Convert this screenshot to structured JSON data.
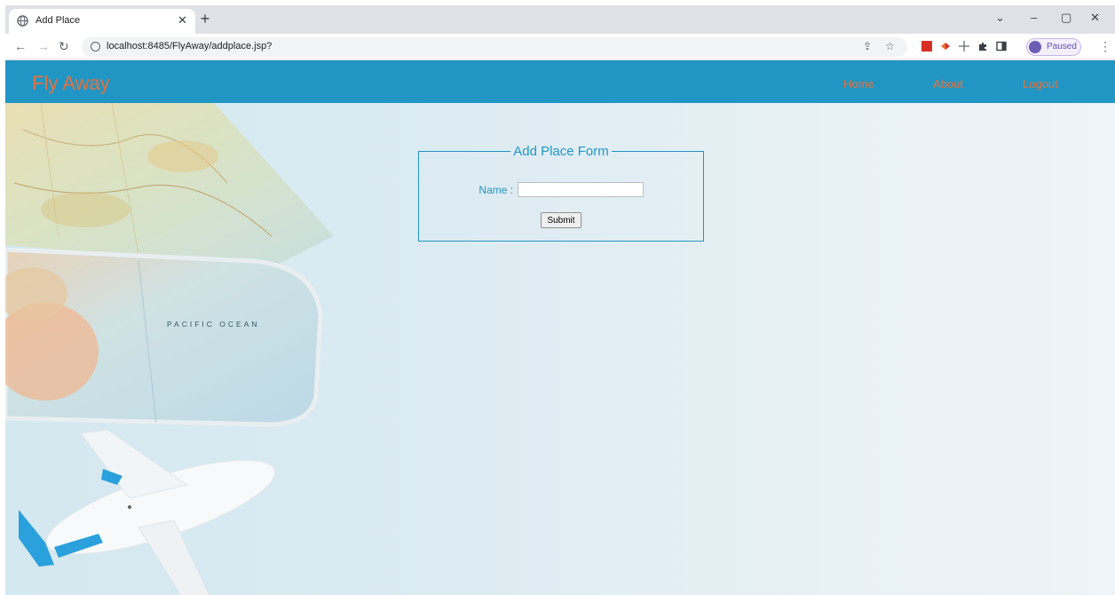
{
  "browser": {
    "tab_title": "Add Place",
    "url": "localhost:8485/FlyAway/addplace.jsp?",
    "profile_label": "Paused"
  },
  "site": {
    "brand": "Fly Away",
    "nav": [
      {
        "label": "Home"
      },
      {
        "label": "About"
      },
      {
        "label": "Logout"
      }
    ]
  },
  "form": {
    "legend": "Add Place Form",
    "name_label": "Name :",
    "name_value": "",
    "submit_label": "Submit"
  },
  "hero": {
    "map_text": "PACIFIC OCEAN"
  },
  "colors": {
    "navbar": "#2196c4",
    "brand_and_links": "#e8703a",
    "form_accent": "#2196c4"
  }
}
